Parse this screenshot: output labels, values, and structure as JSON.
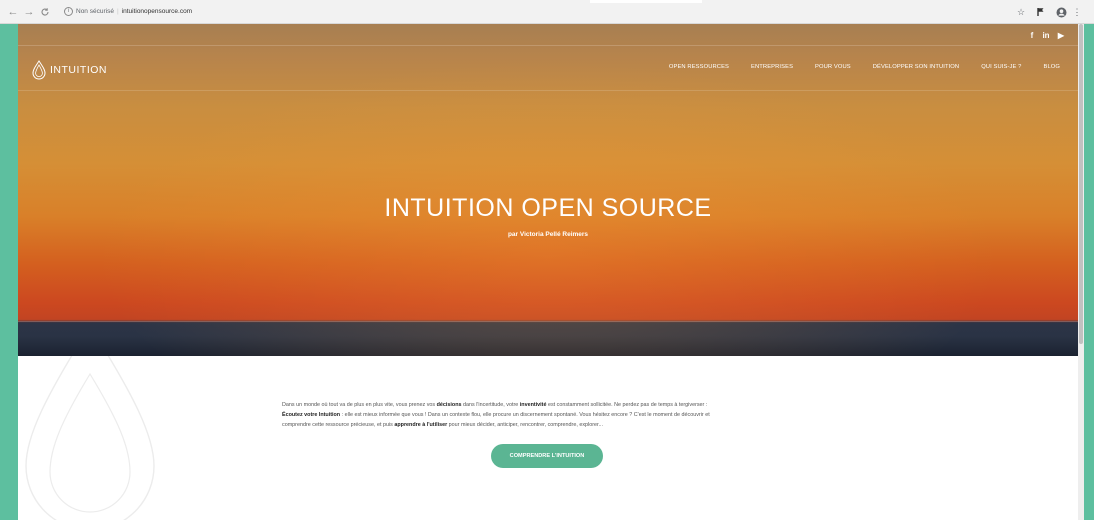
{
  "browser": {
    "address_secure_label": "Non sécurisé",
    "address_separator": "|",
    "address_host": "intuitionopensource.com"
  },
  "social": {
    "facebook": "f",
    "linkedin": "in",
    "youtube": "▶"
  },
  "logo": {
    "text": "INTUITION"
  },
  "nav": {
    "items": [
      "OPEN RESSOURCES",
      "ENTREPRISES",
      "POUR VOUS",
      "DÉVELOPPER SON INTUITION",
      "QUI SUIS-JE ?",
      "BLOG"
    ]
  },
  "hero": {
    "title": "INTUITION OPEN SOURCE",
    "subtitle": "par Victoria Pellé Reimers"
  },
  "intro": {
    "p1_a": "Dans un monde où tout va de plus en plus vite, vous prenez vos ",
    "p1_b": "décisions",
    "p1_c": " dans l'incertitude, votre ",
    "p1_d": "inventivité",
    "p1_e": " est constamment sollicitée. Ne perdez pas de temps à tergiverser :",
    "p2_a": "Écoutez votre Intuition",
    "p2_b": " : elle est mieux informée que vous ! Dans un contexte flou, elle procure un discernement spontané. Vous hésitez encore ? C'est le moment de découvrir et",
    "p3_a": "comprendre cette ressource précieuse, et puis ",
    "p3_b": "apprendre à l'utiliser",
    "p3_c": " pour mieux décider, anticiper, rencontrer, comprendre, explorer..."
  },
  "cta": {
    "label": "COMPRENDRE L'INTUITION"
  },
  "colors": {
    "frame": "#5dbf9f",
    "accent": "#5bb593",
    "hero_top": "#a77f52",
    "hero_horizon": "#c24422",
    "sea": "#2a3345"
  },
  "icons": {
    "back": "back-arrow-icon",
    "forward": "forward-arrow-icon",
    "reload": "reload-icon",
    "info": "info-icon",
    "star": "star-icon",
    "extension": "flag-icon",
    "account": "account-icon",
    "menu": "kebab-menu-icon",
    "logo": "drop-logo-icon"
  }
}
